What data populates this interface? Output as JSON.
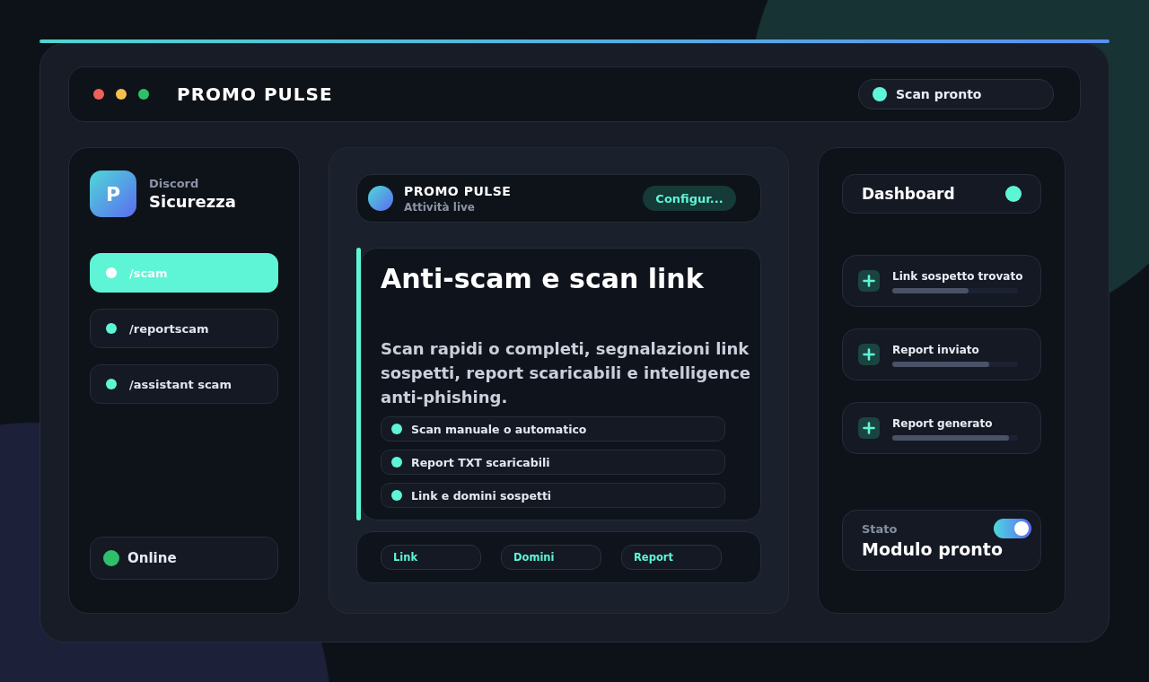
{
  "window": {
    "title": "PROMO PULSE",
    "controls": [
      {
        "color": "#f0605a"
      },
      {
        "color": "#f4c150"
      },
      {
        "color": "#2fbf6a"
      }
    ]
  },
  "status_pill": {
    "label": "Scan pronto"
  },
  "sidebar": {
    "logo": "P",
    "caption": "Discord",
    "title": "Sicurezza",
    "items": [
      {
        "label": "/scam",
        "selected": true
      },
      {
        "label": "/reportscam",
        "selected": false
      },
      {
        "label": "/assistant scam",
        "selected": false
      }
    ],
    "status": {
      "label": "Online"
    }
  },
  "main": {
    "header": {
      "title": "PROMO PULSE",
      "subtitle": "Attività live",
      "button": "Configur..."
    },
    "hero": {
      "title": "Anti-scam e scan link",
      "description": "Scan rapidi o completi, segnalazioni link sospetti, report scaricabili e intelligence anti-phishing.",
      "features": [
        "Scan manuale o automatico",
        "Report TXT scaricabili",
        "Link e domini sospetti"
      ]
    },
    "chips": [
      "Link",
      "Domini",
      "Report"
    ]
  },
  "activity": {
    "title": "Dashboard",
    "events": [
      {
        "label": "Link sospetto trovato",
        "level": 0.61
      },
      {
        "label": "Report inviato",
        "level": 0.77
      },
      {
        "label": "Report generato",
        "level": 0.93
      }
    ],
    "status": {
      "caption": "Stato",
      "label": "Modulo pronto",
      "on": true
    }
  }
}
